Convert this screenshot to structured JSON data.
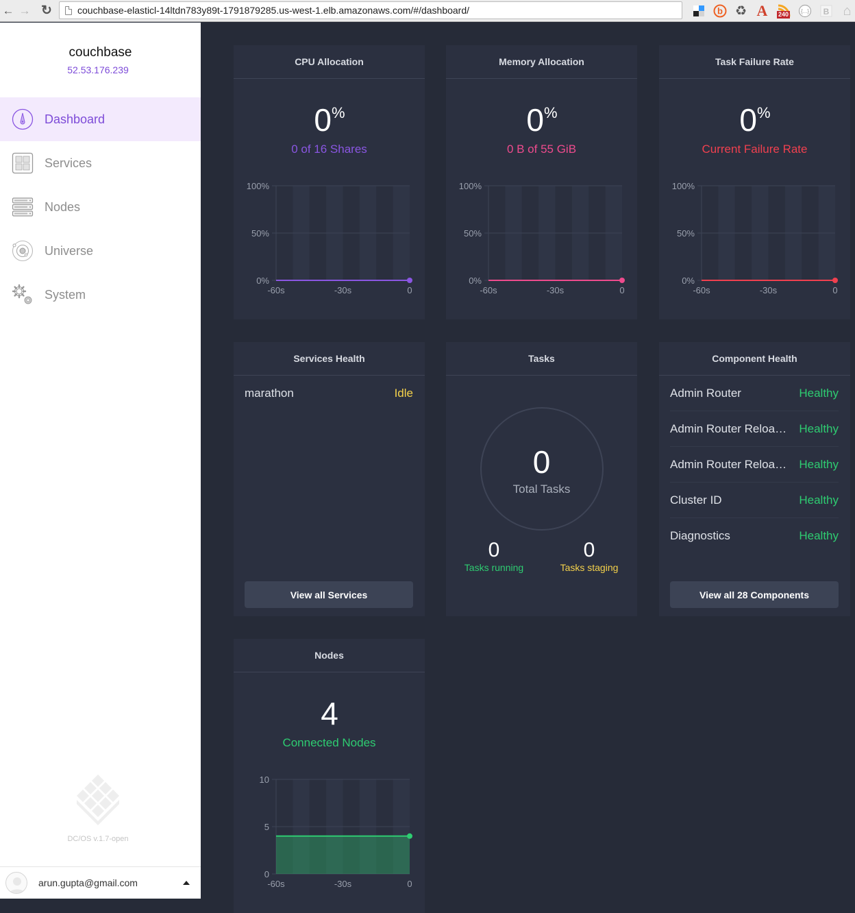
{
  "browser": {
    "url": "couchbase-elasticl-14ltdn783y89t-1791879285.us-west-1.elb.amazonaws.com/#/dashboard/",
    "back_icon": "arrow-left-icon",
    "forward_icon": "arrow-right-icon",
    "reload_icon": "reload-icon",
    "extensions": [
      {
        "name": "delicious-extension-icon",
        "glyph": ""
      },
      {
        "name": "bitly-extension-icon",
        "glyph": "b"
      },
      {
        "name": "recycle-extension-icon",
        "glyph": "♻"
      },
      {
        "name": "font-extension-icon",
        "glyph": "A"
      },
      {
        "name": "rss-extension-icon",
        "glyph": "",
        "badge": "240"
      },
      {
        "name": "json-extension-icon",
        "glyph": "{...}"
      },
      {
        "name": "bookmark-extension-icon",
        "glyph": "B"
      },
      {
        "name": "home-extension-icon",
        "glyph": "⌂"
      }
    ]
  },
  "sidebar": {
    "cluster_name": "couchbase",
    "cluster_ip": "52.53.176.239",
    "items": [
      {
        "label": "Dashboard",
        "icon": "dashboard-gauge-icon",
        "active": true
      },
      {
        "label": "Services",
        "icon": "services-grid-icon",
        "active": false
      },
      {
        "label": "Nodes",
        "icon": "nodes-server-icon",
        "active": false
      },
      {
        "label": "Universe",
        "icon": "universe-orbit-icon",
        "active": false
      },
      {
        "label": "System",
        "icon": "system-gears-icon",
        "active": false
      }
    ],
    "version": "DC/OS v.1.7-open",
    "user_email": "arun.gupta@gmail.com"
  },
  "colors": {
    "accent_purple": "#8a56e2",
    "memory_pink": "#ee4b8d",
    "failure_red": "#f0404f",
    "healthy_green": "#2ecc71",
    "idle_yellow": "#f5d24b"
  },
  "panels": {
    "cpu": {
      "title": "CPU Allocation",
      "value": "0",
      "unit": "%",
      "sub_label": "0 of 16 Shares"
    },
    "memory": {
      "title": "Memory Allocation",
      "value": "0",
      "unit": "%",
      "sub_label": "0 B of 55 GiB"
    },
    "failure": {
      "title": "Task Failure Rate",
      "value": "0",
      "unit": "%",
      "sub_label": "Current Failure Rate"
    },
    "services_health": {
      "title": "Services Health",
      "rows": [
        {
          "name": "marathon",
          "status": "Idle"
        }
      ],
      "button": "View all Services"
    },
    "tasks": {
      "title": "Tasks",
      "total": "0",
      "total_label": "Total Tasks",
      "running": "0",
      "running_label": "Tasks running",
      "staging": "0",
      "staging_label": "Tasks staging"
    },
    "component_health": {
      "title": "Component Health",
      "rows": [
        {
          "name": "Admin Router",
          "status": "Healthy"
        },
        {
          "name": "Admin Router Reloa…",
          "status": "Healthy"
        },
        {
          "name": "Admin Router Reloa…",
          "status": "Healthy"
        },
        {
          "name": "Cluster ID",
          "status": "Healthy"
        },
        {
          "name": "Diagnostics",
          "status": "Healthy"
        }
      ],
      "button": "View all 28 Components"
    },
    "nodes": {
      "title": "Nodes",
      "value": "4",
      "sub_label": "Connected Nodes"
    }
  },
  "chart_data": [
    {
      "id": "cpu",
      "type": "line",
      "title": "CPU Allocation",
      "x_ticks": [
        "-60s",
        "-30s",
        "0"
      ],
      "y_ticks": [
        "0%",
        "50%",
        "100%"
      ],
      "ylim": [
        0,
        100
      ],
      "xlim": [
        -60,
        0
      ],
      "series": [
        {
          "name": "cpu",
          "color": "#8a56e2",
          "x": [
            -60,
            0
          ],
          "values": [
            0,
            0
          ]
        }
      ],
      "grid": true,
      "area": false
    },
    {
      "id": "memory",
      "type": "line",
      "title": "Memory Allocation",
      "x_ticks": [
        "-60s",
        "-30s",
        "0"
      ],
      "y_ticks": [
        "0%",
        "50%",
        "100%"
      ],
      "ylim": [
        0,
        100
      ],
      "xlim": [
        -60,
        0
      ],
      "series": [
        {
          "name": "memory",
          "color": "#ee4b8d",
          "x": [
            -60,
            0
          ],
          "values": [
            0,
            0
          ]
        }
      ],
      "grid": true,
      "area": false
    },
    {
      "id": "failure",
      "type": "line",
      "title": "Task Failure Rate",
      "x_ticks": [
        "-60s",
        "-30s",
        "0"
      ],
      "y_ticks": [
        "0%",
        "50%",
        "100%"
      ],
      "ylim": [
        0,
        100
      ],
      "xlim": [
        -60,
        0
      ],
      "series": [
        {
          "name": "failure",
          "color": "#f0404f",
          "x": [
            -60,
            0
          ],
          "values": [
            0,
            0
          ]
        }
      ],
      "grid": true,
      "area": false
    },
    {
      "id": "nodes",
      "type": "area",
      "title": "Nodes",
      "x_ticks": [
        "-60s",
        "-30s",
        "0"
      ],
      "y_ticks": [
        "0",
        "5",
        "10"
      ],
      "ylim": [
        0,
        10
      ],
      "xlim": [
        -60,
        0
      ],
      "series": [
        {
          "name": "nodes",
          "color": "#2ecc71",
          "x": [
            -60,
            0
          ],
          "values": [
            4,
            4
          ]
        }
      ],
      "grid": true,
      "area": true
    }
  ]
}
